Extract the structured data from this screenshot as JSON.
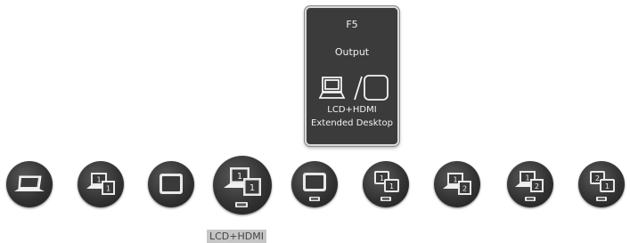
{
  "card": {
    "key": "F5",
    "title": "Output",
    "mode_line1": "LCD+HDMI",
    "mode_line2": "Extended Desktop"
  },
  "options": [
    {
      "icon": "laptop-icon"
    },
    {
      "icon": "laptop-plus-monitor-1-icon",
      "badges": [
        "1",
        "1"
      ]
    },
    {
      "icon": "monitor-icon"
    },
    {
      "icon": "laptop-plus-monitor-hdmi-icon",
      "badges": [
        "1",
        "1"
      ],
      "selected": true
    },
    {
      "icon": "monitor-hdmi-icon"
    },
    {
      "icon": "monitor-plus-monitor-hdmi-icon",
      "badges": [
        "1",
        "1"
      ]
    },
    {
      "icon": "laptop-extended-monitor-icon",
      "badges": [
        "1",
        "2"
      ]
    },
    {
      "icon": "laptop-extended-monitor-hdmi-icon",
      "badges": [
        "1",
        "2"
      ]
    },
    {
      "icon": "monitor-extended-monitor-hdmi-icon",
      "badges": [
        "2",
        "1"
      ]
    }
  ],
  "selected_label": "LCD+HDMI"
}
